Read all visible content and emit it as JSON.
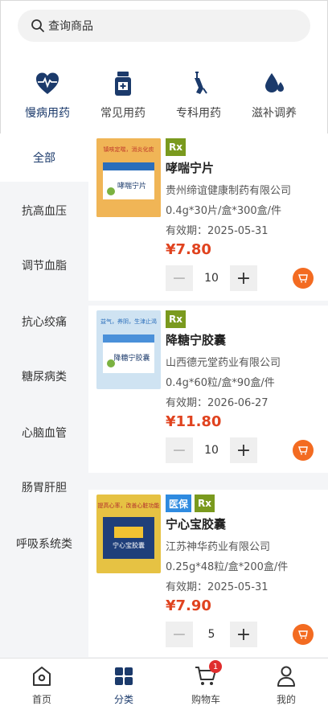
{
  "search": {
    "placeholder": "查询商品",
    "icon": "search-icon"
  },
  "categories": [
    {
      "label": "慢病用药",
      "icon": "heart-pulse-icon"
    },
    {
      "label": "常见用药",
      "icon": "pill-bottle-icon"
    },
    {
      "label": "专科用药",
      "icon": "injection-icon"
    },
    {
      "label": "滋补调养",
      "icon": "drop-icon"
    }
  ],
  "active_category": "慢病用药",
  "sidebar": {
    "items": [
      "全部",
      "抗高血压",
      "调节血脂",
      "抗心绞痛",
      "糖尿病类",
      "心脑血管",
      "肠胃肝胆",
      "呼吸系统类"
    ],
    "active": "全部"
  },
  "products": [
    {
      "badges": [
        "Rx"
      ],
      "name": "哮喘宁片",
      "company": "贵州缔谊健康制药有限公司",
      "spec": "0.4g*30片/盒*300盒/件",
      "expiry": "有效期：2025-05-31",
      "price": "¥7.80",
      "qty": "10",
      "pack_text": "哮喘宁片",
      "pack_banner": "镇咳定喘，消炎化痰",
      "pack_color": "#e8a94a"
    },
    {
      "badges": [
        "Rx"
      ],
      "name": "降糖宁胶囊",
      "company": "山西德元堂药业有限公司",
      "spec": "0.4g*60粒/盒*90盒/件",
      "expiry": "有效期：2026-06-27",
      "price": "¥11.80",
      "qty": "10",
      "pack_text": "降糖宁胶囊",
      "pack_banner": "益气，养阴，生津止渴",
      "pack_color": "#cfe3f2"
    },
    {
      "badges": [
        "医保",
        "Rx"
      ],
      "name": "宁心宝胶囊",
      "company": "江苏神华药业有限公司",
      "spec": "0.25g*48粒/盒*200盒/件",
      "expiry": "有效期：2025-05-31",
      "price": "¥7.90",
      "qty": "5",
      "pack_text": "宁心宝胶囊",
      "pack_banner": "提高心率，改善心脏功能",
      "pack_color": "#e6c243"
    }
  ],
  "bottom_nav": [
    {
      "label": "首页",
      "icon": "home-icon"
    },
    {
      "label": "分类",
      "icon": "category-icon"
    },
    {
      "label": "购物车",
      "icon": "cart-icon",
      "badge": "1"
    },
    {
      "label": "我的",
      "icon": "user-icon"
    }
  ],
  "active_nav": "分类",
  "colors": {
    "accent": "#1b3a6b",
    "price": "#e0431f",
    "cart": "#f36b21",
    "rx": "#7a9a1e",
    "medical": "#2f8be0"
  }
}
